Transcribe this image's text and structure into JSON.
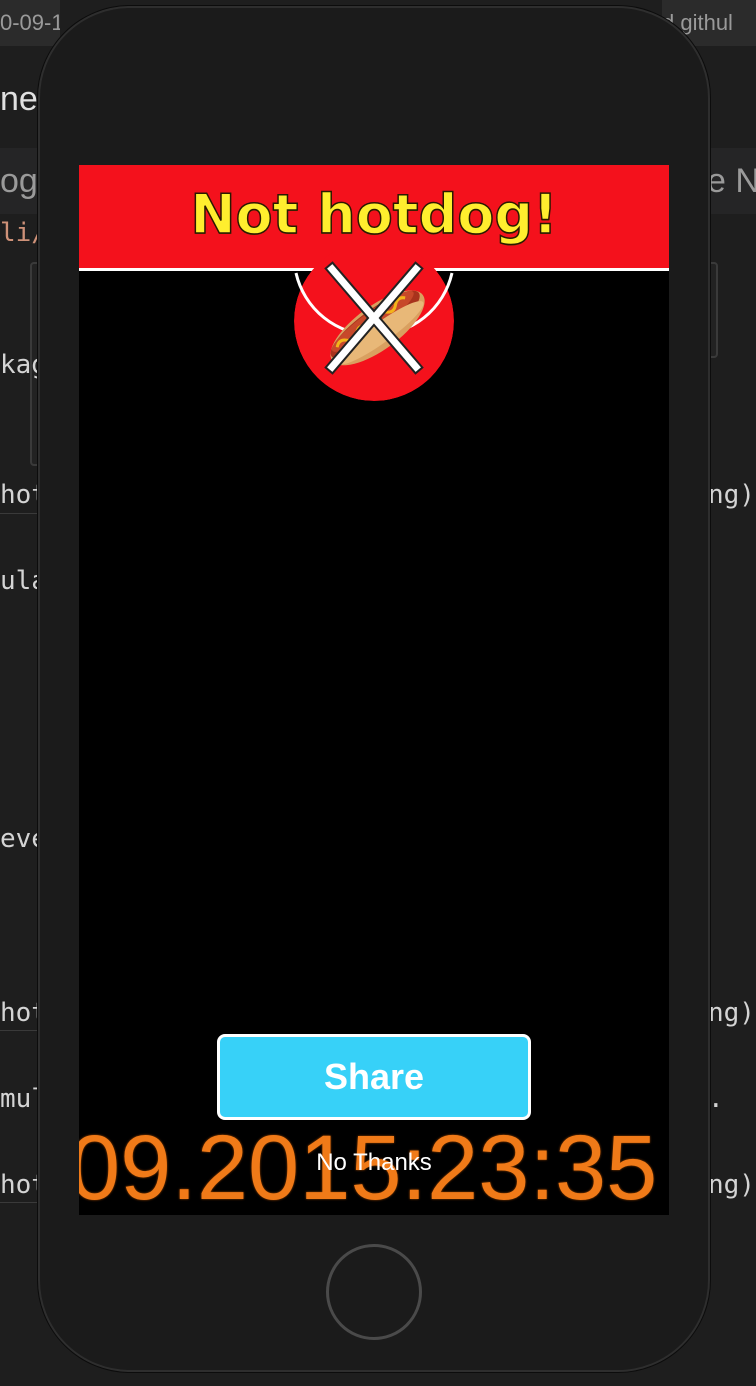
{
  "background": {
    "tab_left": "0-09-1",
    "tab_right": "d.githul",
    "title_left": "ne",
    "tab2_left": "og",
    "tab2_right": "ve N",
    "frags_left": [
      "li/",
      "kag",
      "hot",
      "ula",
      "eve",
      "hot",
      "mul",
      "hot"
    ],
    "frags_right": [
      "ng)",
      "ng)",
      ".",
      "ng)"
    ]
  },
  "app": {
    "banner_title": "Not hotdog!",
    "badge_icon": "hotdog-crossed-icon",
    "share_label": "Share",
    "no_thanks_label": "No Thanks",
    "timestamp_overlay": "09.2015:23:35",
    "colors": {
      "banner_red": "#f4111c",
      "title_yellow": "#ffee2e",
      "share_blue": "#37d1f8",
      "timestamp_orange": "#f07a18"
    }
  }
}
